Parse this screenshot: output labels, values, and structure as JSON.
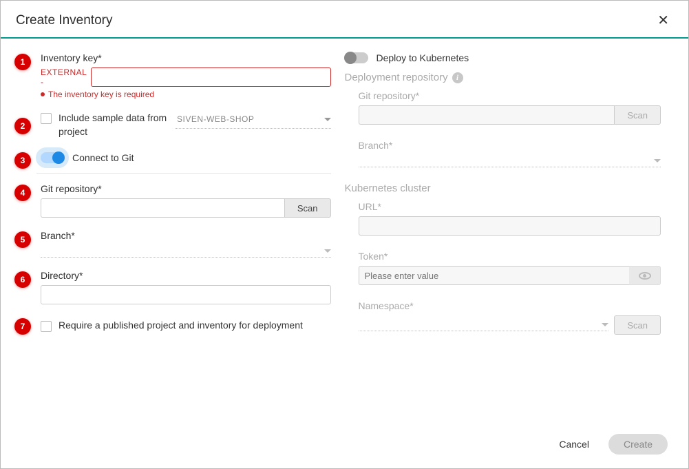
{
  "dialog": {
    "title": "Create Inventory"
  },
  "left": {
    "inventory_key_label": "Inventory key*",
    "inventory_key_prefix": "EXTERNAL -",
    "inventory_key_error": "The inventory key is required",
    "include_sample_label": "Include sample data from project",
    "include_sample_project": "SIVEN-WEB-SHOP",
    "connect_git_label": "Connect to Git",
    "git_repo_label": "Git repository*",
    "scan_label": "Scan",
    "branch_label": "Branch*",
    "directory_label": "Directory*",
    "require_published_label": "Require a published project and inventory for deployment"
  },
  "right": {
    "deploy_k8s_label": "Deploy to Kubernetes",
    "deployment_repo_title": "Deployment repository",
    "git_repo_label": "Git repository*",
    "scan_label": "Scan",
    "branch_label": "Branch*",
    "k8s_cluster_title": "Kubernetes cluster",
    "url_label": "URL*",
    "token_label": "Token*",
    "token_placeholder": "Please enter value",
    "namespace_label": "Namespace*",
    "scan2_label": "Scan"
  },
  "footer": {
    "cancel": "Cancel",
    "create": "Create"
  },
  "badges": [
    "1",
    "2",
    "3",
    "4",
    "5",
    "6",
    "7"
  ]
}
